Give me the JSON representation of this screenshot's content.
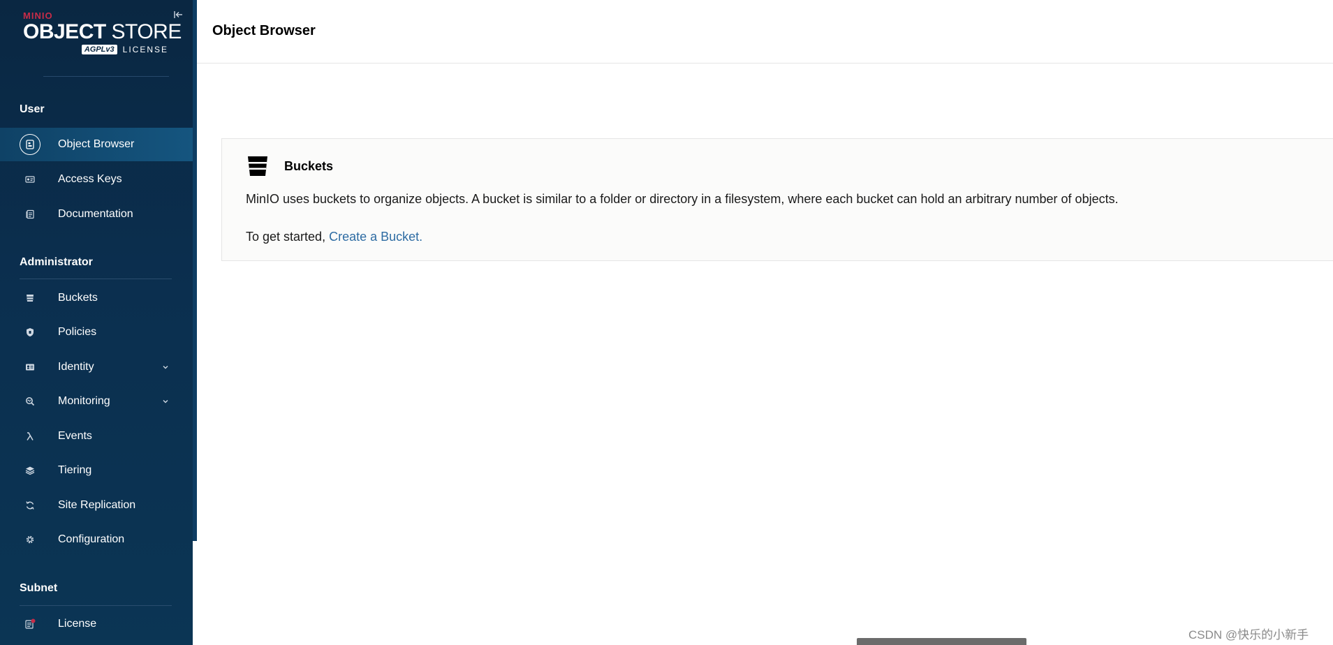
{
  "app": {
    "brand_small": "MINIO",
    "brand_title_bold": "OBJECT",
    "brand_title_light": "STORE",
    "agpl_badge": "AGPLv3",
    "license_label": "LICENSE"
  },
  "sidebar": {
    "sections": [
      {
        "title": "User",
        "items": [
          {
            "label": "Object Browser",
            "icon": "object-browser-icon",
            "active": true
          },
          {
            "label": "Access Keys",
            "icon": "access-keys-icon"
          },
          {
            "label": "Documentation",
            "icon": "documentation-icon"
          }
        ]
      },
      {
        "title": "Administrator",
        "items": [
          {
            "label": "Buckets",
            "icon": "bucket-icon"
          },
          {
            "label": "Policies",
            "icon": "policies-icon"
          },
          {
            "label": "Identity",
            "icon": "identity-icon",
            "expandable": true
          },
          {
            "label": "Monitoring",
            "icon": "monitoring-icon",
            "expandable": true
          },
          {
            "label": "Events",
            "icon": "lambda-icon"
          },
          {
            "label": "Tiering",
            "icon": "tiering-icon"
          },
          {
            "label": "Site Replication",
            "icon": "site-replication-icon"
          },
          {
            "label": "Configuration",
            "icon": "gear-icon"
          }
        ]
      },
      {
        "title": "Subnet",
        "items": [
          {
            "label": "License",
            "icon": "license-icon",
            "badge_color": "#c72c48"
          }
        ]
      }
    ]
  },
  "header": {
    "title": "Object Browser"
  },
  "empty_state": {
    "title": "Buckets",
    "description": "MinIO uses buckets to organize objects. A bucket is similar to a folder or directory in a filesystem, where each bucket can hold an arbitrary number of objects.",
    "cta_prefix": "To get started, ",
    "cta_link": "Create a Bucket."
  },
  "watermark": "CSDN @快乐的小新手",
  "colors": {
    "sidebar_bg": "#0b2f4f",
    "active_item_bg": "#15557f",
    "brand_red": "#c72c48",
    "link": "#2e6ca3"
  }
}
